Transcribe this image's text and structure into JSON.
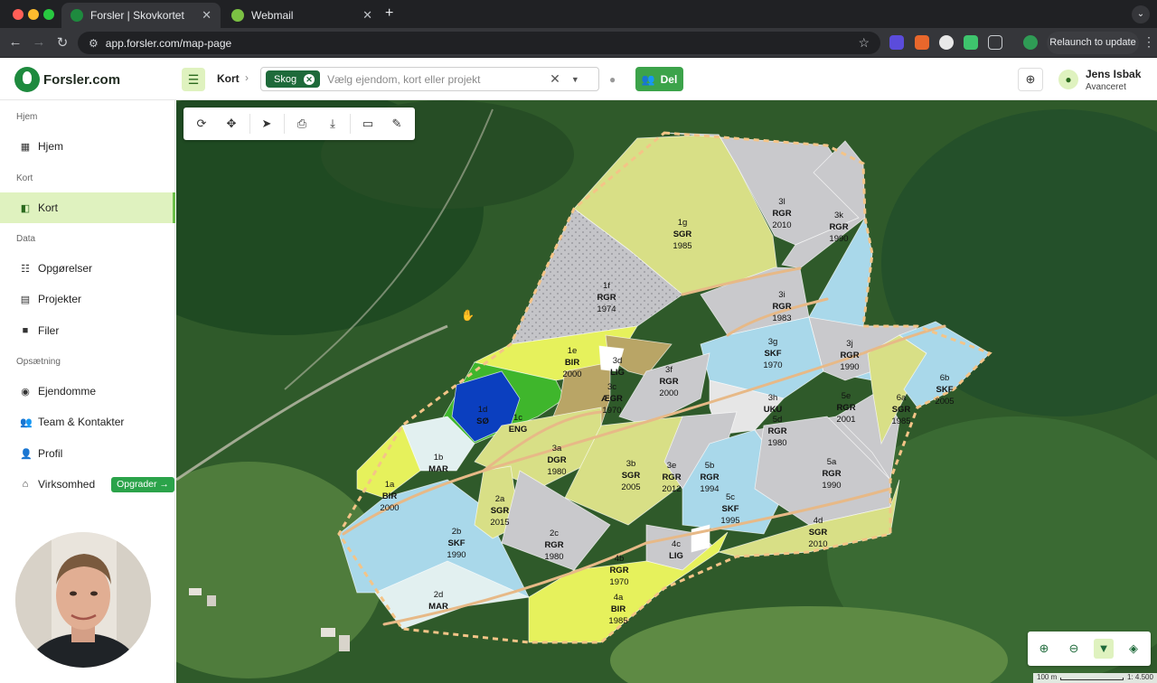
{
  "browser": {
    "tabs": [
      {
        "title": "Forsler | Skovkortet",
        "active": true
      },
      {
        "title": "Webmail",
        "active": false
      }
    ],
    "url": "app.forsler.com/map-page",
    "relaunch_label": "Relaunch to update"
  },
  "app": {
    "logo_text": "Forsler.com",
    "breadcrumb": "Kort",
    "search": {
      "chip": "Skog",
      "placeholder": "Vælg ejendom, kort eller projekt"
    },
    "share_label": "Del",
    "user": {
      "name": "Jens Isbak",
      "role": "Avanceret"
    }
  },
  "sidebar": {
    "sections": [
      {
        "title": "Hjem",
        "items": [
          {
            "label": "Hjem",
            "icon": "dashboard-icon"
          }
        ]
      },
      {
        "title": "Kort",
        "items": [
          {
            "label": "Kort",
            "icon": "map-icon",
            "active": true
          }
        ]
      },
      {
        "title": "Data",
        "items": [
          {
            "label": "Opgørelser",
            "icon": "table-icon"
          },
          {
            "label": "Projekter",
            "icon": "clipboard-icon"
          },
          {
            "label": "Filer",
            "icon": "folder-icon"
          }
        ]
      },
      {
        "title": "Opsætning",
        "items": [
          {
            "label": "Ejendomme",
            "icon": "pin-icon"
          },
          {
            "label": "Team & Kontakter",
            "icon": "people-icon"
          },
          {
            "label": "Profil",
            "icon": "person-icon"
          },
          {
            "label": "Virksomhed",
            "icon": "home-icon"
          }
        ]
      }
    ],
    "upgrade_label": "Opgrader →"
  },
  "map": {
    "scale": {
      "distance": "100 m",
      "ratio": "1: 4.500"
    },
    "stands": [
      {
        "id": "1a",
        "species": "BIR",
        "year": "2000"
      },
      {
        "id": "1b",
        "species": "MAR",
        "year": ""
      },
      {
        "id": "1c",
        "species": "ENG",
        "year": ""
      },
      {
        "id": "1d",
        "species": "SØ",
        "year": ""
      },
      {
        "id": "1e",
        "species": "BIR",
        "year": "2000"
      },
      {
        "id": "1f",
        "species": "RGR",
        "year": "1974"
      },
      {
        "id": "1g",
        "species": "SGR",
        "year": "1985"
      },
      {
        "id": "2a",
        "species": "SGR",
        "year": "2015"
      },
      {
        "id": "2b",
        "species": "SKF",
        "year": "1990"
      },
      {
        "id": "2c",
        "species": "RGR",
        "year": "1980"
      },
      {
        "id": "2d",
        "species": "MAR",
        "year": ""
      },
      {
        "id": "3a",
        "species": "DGR",
        "year": "1980"
      },
      {
        "id": "3b",
        "species": "SGR",
        "year": "2005"
      },
      {
        "id": "3c",
        "species": "ÆGR",
        "year": "1970"
      },
      {
        "id": "3d",
        "species": "LIG",
        "year": ""
      },
      {
        "id": "3e",
        "species": "RGR",
        "year": "2012"
      },
      {
        "id": "3f",
        "species": "RGR",
        "year": "2000"
      },
      {
        "id": "3g",
        "species": "SKF",
        "year": "1970"
      },
      {
        "id": "3h",
        "species": "UKU",
        "year": ""
      },
      {
        "id": "3i",
        "species": "RGR",
        "year": "1983"
      },
      {
        "id": "3j",
        "species": "RGR",
        "year": "1990"
      },
      {
        "id": "3k",
        "species": "RGR",
        "year": "1990"
      },
      {
        "id": "3l",
        "species": "RGR",
        "year": "2010"
      },
      {
        "id": "4a",
        "species": "BIR",
        "year": "1985"
      },
      {
        "id": "4b",
        "species": "RGR",
        "year": "1970"
      },
      {
        "id": "4c",
        "species": "LIG",
        "year": ""
      },
      {
        "id": "4d",
        "species": "SGR",
        "year": "2010"
      },
      {
        "id": "5a",
        "species": "RGR",
        "year": "1990"
      },
      {
        "id": "5b",
        "species": "RGR",
        "year": "1994"
      },
      {
        "id": "5c",
        "species": "SKF",
        "year": "1995"
      },
      {
        "id": "5d",
        "species": "RGR",
        "year": "1980"
      },
      {
        "id": "5e",
        "species": "RGR",
        "year": "2001"
      },
      {
        "id": "6a",
        "species": "SGR",
        "year": "1985"
      },
      {
        "id": "6b",
        "species": "SKF",
        "year": "2005"
      }
    ]
  },
  "colors": {
    "brand": "#1e8a3e",
    "accent_light": "#dff2bf",
    "share_button": "#3ca34a",
    "stand_rgr": "#c9c9cc",
    "stand_sgr": "#d8df86",
    "stand_skf": "#a9d8ea",
    "stand_bir": "#e6f15c",
    "stand_lake": "#0b3fbf",
    "stand_meadow": "#3fb62c",
    "stand_aegr": "#b9a566",
    "stand_mar": "#e2f0f0"
  }
}
